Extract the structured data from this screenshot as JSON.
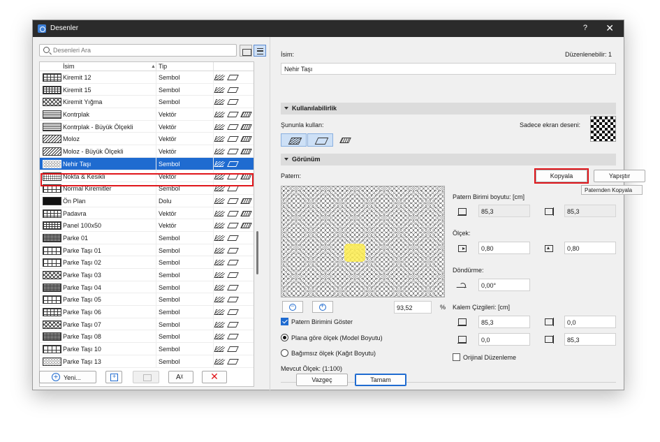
{
  "window": {
    "title": "Desenler",
    "help": "?",
    "close": "✕"
  },
  "left": {
    "search_placeholder": "Desenleri Ara",
    "columns": {
      "name": "İsim",
      "type": "Tip"
    },
    "rows": [
      {
        "name": "Kiremit 12",
        "type": "Sembol",
        "swatch": "brick"
      },
      {
        "name": "Kiremit 15",
        "type": "Sembol",
        "swatch": "brick2"
      },
      {
        "name": "Kiremit Yığma",
        "type": "Sembol",
        "swatch": "cross"
      },
      {
        "name": "Kontrplak",
        "type": "Vektör",
        "swatch": "lines"
      },
      {
        "name": "Kontrplak - Büyük Ölçekli",
        "type": "Vektör",
        "swatch": "lines"
      },
      {
        "name": "Moloz",
        "type": "Vektör",
        "swatch": "diag"
      },
      {
        "name": "Moloz - Büyük Ölçekli",
        "type": "Vektör",
        "swatch": "diag"
      },
      {
        "name": "Nehir Taşı",
        "type": "Sembol",
        "swatch": "stone",
        "selected": true
      },
      {
        "name": "Nokta & Kesikli",
        "type": "Vektör",
        "swatch": "dots"
      },
      {
        "name": "Normal Kiremitler",
        "type": "Sembol",
        "swatch": "tile"
      },
      {
        "name": "Ön Plan",
        "type": "Dolu",
        "swatch": "solid"
      },
      {
        "name": "Padavra",
        "type": "Vektör",
        "swatch": "brick"
      },
      {
        "name": "Panel 100x50",
        "type": "Vektör",
        "swatch": "brick2"
      },
      {
        "name": "Parke 01",
        "type": "Sembol",
        "swatch": "dense"
      },
      {
        "name": "Parke Taşı 01",
        "type": "Sembol",
        "swatch": "tile"
      },
      {
        "name": "Parke Taşı 02",
        "type": "Sembol",
        "swatch": "tile"
      },
      {
        "name": "Parke Taşı 03",
        "type": "Sembol",
        "swatch": "cross"
      },
      {
        "name": "Parke Taşı 04",
        "type": "Sembol",
        "swatch": "dense"
      },
      {
        "name": "Parke Taşı 05",
        "type": "Sembol",
        "swatch": "tile"
      },
      {
        "name": "Parke Taşı 06",
        "type": "Sembol",
        "swatch": "brick"
      },
      {
        "name": "Parke Taşı 07",
        "type": "Sembol",
        "swatch": "cross"
      },
      {
        "name": "Parke Taşı 08",
        "type": "Sembol",
        "swatch": "dense"
      },
      {
        "name": "Parke Taşı 10",
        "type": "Sembol",
        "swatch": "tile"
      },
      {
        "name": "Parke Taşı 13",
        "type": "Sembol",
        "swatch": "stone"
      }
    ],
    "buttons": {
      "new": "Yeni...",
      "rename": "Aᵡ",
      "delete": "✕"
    }
  },
  "right": {
    "name_label": "İsim:",
    "editable": "Düzenlenebilir: 1",
    "name_value": "Nehir Taşı",
    "availability_section": "Kullanılabilirlik",
    "use_for": "Şununla kullan:",
    "screen_only": "Sadece ekran deseni:",
    "appearance_section": "Görünüm",
    "pattern_label": "Patern:",
    "copy": "Kopyala",
    "paste": "Yapıştır",
    "tooltip": "Paternden Kopyala",
    "unit_size_label": "Patern Birimi boyutu: [cm]",
    "unit_w": "85,3",
    "unit_h": "85,3",
    "scale_label": "Ölçek:",
    "scale_x": "0,80",
    "scale_y": "0,80",
    "rotation_label": "Döndürme:",
    "rotation": "0,00°",
    "zoom_value": "93,52",
    "zoom_unit": "%",
    "show_unit": "Patern Birimini Göster",
    "radio_model": "Plana göre ölçek (Model Boyutu)",
    "radio_paper": "Bağımsız ölçek (Kağıt Boyutu)",
    "current_scale": "Mevcut Ölçek: (1:100)",
    "pen_lines_label": "Kalem Çizgileri: [cm]",
    "pen_1": "85,3",
    "pen_2": "0,0",
    "pen_3": "0,0",
    "pen_4": "85,3",
    "original_edit": "Orijinal Düzenleme",
    "cancel": "Vazgeç",
    "ok": "Tamam"
  }
}
